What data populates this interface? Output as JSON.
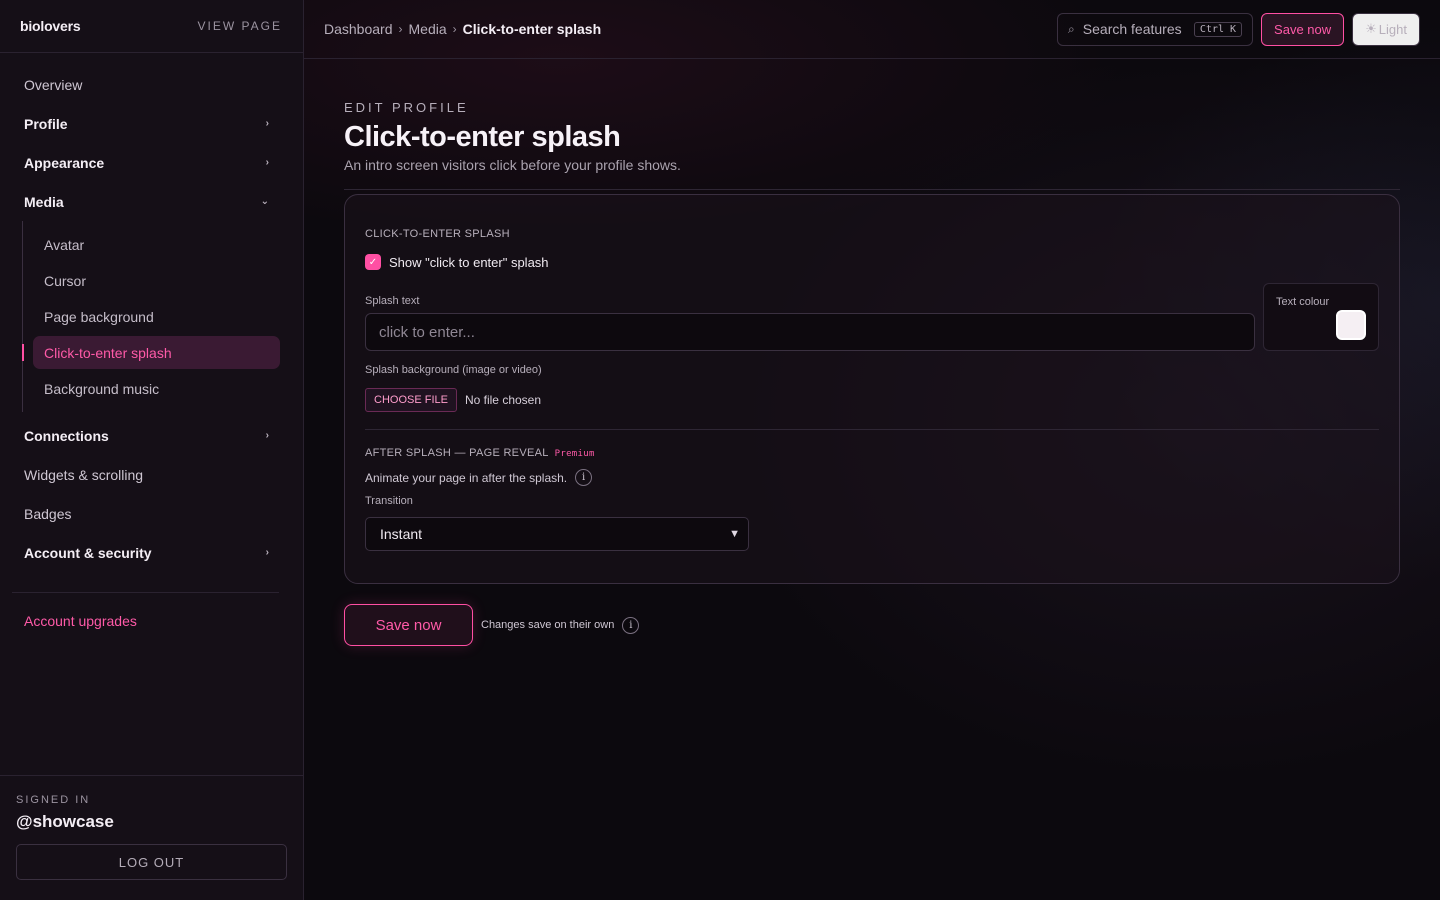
{
  "sidebar": {
    "brand": "biolovers",
    "view_page": "VIEW PAGE",
    "nav": {
      "overview": "Overview",
      "profile": "Profile",
      "appearance": "Appearance",
      "media": "Media",
      "media_items": [
        "Avatar",
        "Cursor",
        "Page background",
        "Click-to-enter splash",
        "Background music"
      ],
      "connections": "Connections",
      "widgets": "Widgets & scrolling",
      "badges": "Badges",
      "account": "Account & security"
    },
    "upgrades": "Account upgrades",
    "signed_in_label": "SIGNED IN",
    "handle": "@showcase",
    "logout": "LOG OUT"
  },
  "topbar": {
    "breadcrumbs": [
      "Dashboard",
      "Media",
      "Click-to-enter splash"
    ],
    "search_placeholder": "Search features",
    "search_shortcut": "Ctrl K",
    "save_label": "Save now",
    "theme_label": "Light"
  },
  "main": {
    "eyebrow": "EDIT PROFILE",
    "title": "Click-to-enter splash",
    "description": "An intro screen visitors click before your profile shows.",
    "card": {
      "section_label": "CLICK-TO-ENTER SPLASH",
      "show_splash_label": "Show \"click to enter\" splash",
      "show_splash_checked": true,
      "splash_text_label": "Splash text",
      "splash_text_placeholder": "click to enter...",
      "text_colour_label": "Text colour",
      "text_colour_value": "#f5eff3",
      "splash_bg_label": "Splash background (image or video)",
      "choose_file": "CHOOSE FILE",
      "no_file": "No file chosen",
      "after_splash_label": "AFTER SPLASH — PAGE REVEAL",
      "premium_badge": "Premium",
      "animate_desc": "Animate your page in after the splash.",
      "transition_label": "Transition",
      "transition_value": "Instant"
    },
    "save_label": "Save now",
    "save_note": "Changes save on their own"
  },
  "colors": {
    "accent": "#ff4fa3",
    "background": "#0c090e",
    "sidebar": "#150f17"
  }
}
